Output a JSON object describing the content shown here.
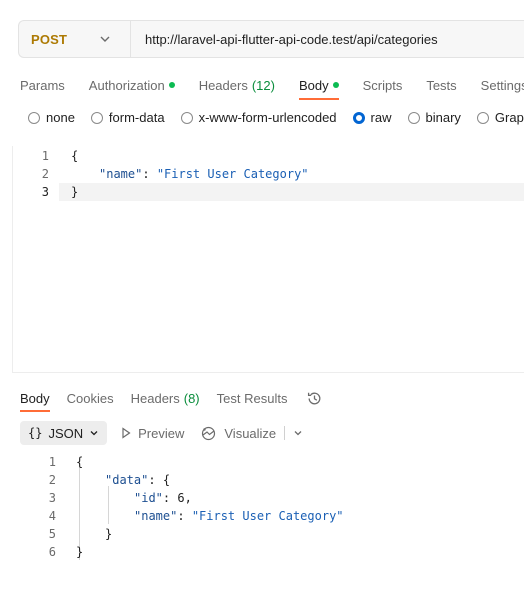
{
  "request": {
    "method": "POST",
    "url": "http://laravel-api-flutter-api-code.test/api/categories",
    "tabs": [
      {
        "label": "Params"
      },
      {
        "label": "Authorization"
      },
      {
        "label": "Headers",
        "count": "(12)"
      },
      {
        "label": "Body"
      },
      {
        "label": "Scripts"
      },
      {
        "label": "Tests"
      },
      {
        "label": "Settings"
      }
    ],
    "body_types": [
      "none",
      "form-data",
      "x-www-form-urlencoded",
      "raw",
      "binary",
      "GraphQL"
    ],
    "selected_body_type": "raw",
    "editor_lines": [
      {
        "num": "1",
        "text": "{"
      },
      {
        "num": "2",
        "key": "\"name\"",
        "sep": ": ",
        "value": "\"First User Category\""
      },
      {
        "num": "3",
        "text": "}"
      }
    ]
  },
  "response": {
    "tabs": [
      {
        "label": "Body"
      },
      {
        "label": "Cookies"
      },
      {
        "label": "Headers",
        "count": "(8)"
      },
      {
        "label": "Test Results"
      }
    ],
    "format": "JSON",
    "format_icon": "{}",
    "preview_label": "Preview",
    "visualize_label": "Visualize",
    "lines": [
      {
        "num": "1",
        "text": "{"
      },
      {
        "num": "2",
        "key": "\"data\"",
        "sep": ": ",
        "text": "{"
      },
      {
        "num": "3",
        "key": "\"id\"",
        "sep": ": ",
        "value": "6",
        "tail": ","
      },
      {
        "num": "4",
        "key": "\"name\"",
        "sep": ": ",
        "value": "\"First User Category\""
      },
      {
        "num": "5",
        "text": "}"
      },
      {
        "num": "6",
        "text": "}"
      }
    ]
  },
  "colors": {
    "method": "#ad7a03",
    "active_underline": "#ff6c37",
    "status_dot": "#0cbb52",
    "radio_selected": "#0265d2"
  }
}
